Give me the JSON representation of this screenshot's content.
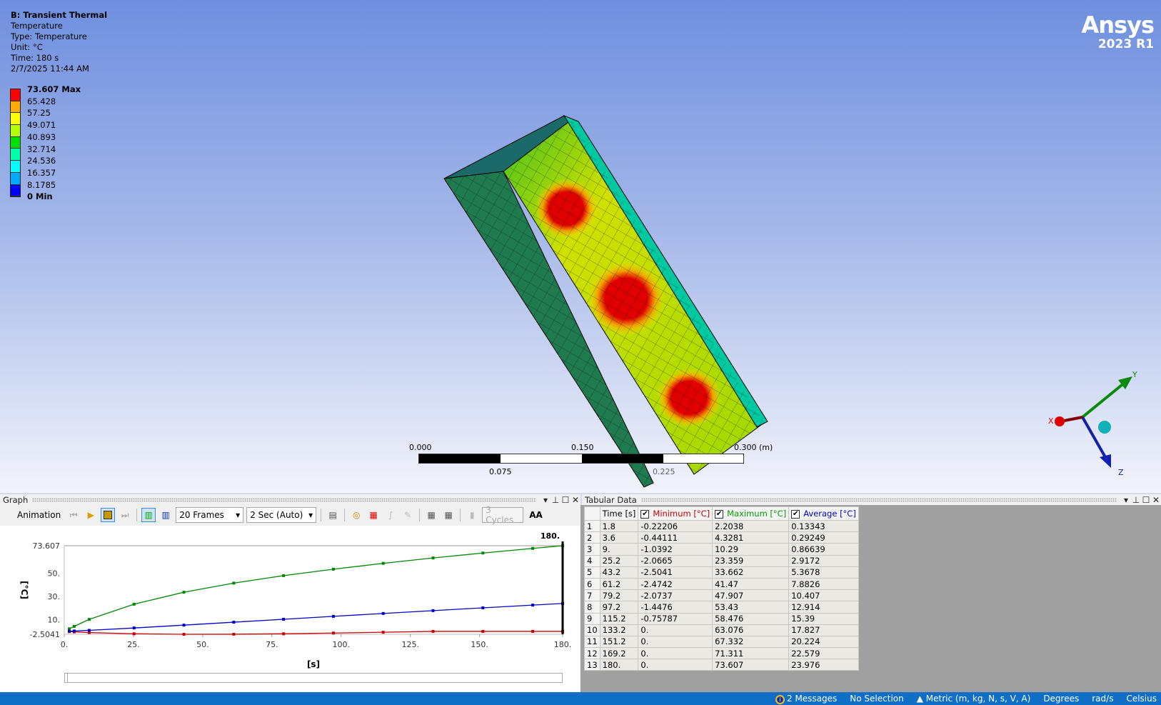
{
  "viewport": {
    "info": {
      "title": "B: Transient Thermal",
      "result": "Temperature",
      "type": "Type: Temperature",
      "unit": "Unit: °C",
      "time": "Time: 180 s",
      "date": "2/7/2025 11:44 AM"
    },
    "legend": {
      "labels": [
        "73.607 Max",
        "65.428",
        "57.25",
        "49.071",
        "40.893",
        "32.714",
        "24.536",
        "16.357",
        "8.1785",
        "0 Min"
      ],
      "colors": [
        "#ff0000",
        "#ffaa00",
        "#ffff00",
        "#b4ff00",
        "#00e000",
        "#00ffaa",
        "#00ffff",
        "#00aaff",
        "#0000ff"
      ]
    },
    "logo": {
      "name": "Ansys",
      "version": "2023 R1"
    },
    "scale_bar": {
      "l0": "0.000",
      "l1": "0.075",
      "l2": "0.150",
      "l3": "0.225",
      "l4": "0.300 (m)"
    },
    "triad": {
      "x": "X",
      "y": "Y",
      "z": "Z"
    }
  },
  "graph": {
    "title": "Graph",
    "toolbar": {
      "animation": "Animation",
      "frames": "20 Frames",
      "duration": "2 Sec (Auto)",
      "cycles": "3 Cycles",
      "aa": "AA"
    }
  },
  "chart_data": {
    "type": "line",
    "xlabel": "[s]",
    "ylabel": "[°C]",
    "xlim": [
      0,
      180
    ],
    "ylim": [
      -2.5041,
      73.607
    ],
    "xticks": [
      "0.",
      "25.",
      "50.",
      "75.",
      "100.",
      "125.",
      "150.",
      "180."
    ],
    "yticks": [
      "73.607",
      "50.",
      "30.",
      "10.",
      "-2.5041"
    ],
    "marker_label": "180.",
    "x": [
      1.8,
      3.6,
      9,
      25.2,
      43.2,
      61.2,
      79.2,
      97.2,
      115.2,
      133.2,
      151.2,
      169.2,
      180
    ],
    "series": [
      {
        "name": "Minimum [°C]",
        "color": "#cc0000",
        "values": [
          -0.22206,
          -0.44111,
          -1.0392,
          -2.0665,
          -2.5041,
          -2.4742,
          -2.0737,
          -1.4476,
          -0.75787,
          0,
          0,
          0,
          0
        ]
      },
      {
        "name": "Maximum [°C]",
        "color": "#008800",
        "values": [
          2.2038,
          4.3281,
          10.29,
          23.359,
          33.662,
          41.47,
          47.907,
          53.43,
          58.476,
          63.076,
          67.332,
          71.311,
          73.607
        ]
      },
      {
        "name": "Average [°C]",
        "color": "#0000cc",
        "values": [
          0.13343,
          0.29249,
          0.86639,
          2.9172,
          5.3678,
          7.8826,
          10.407,
          12.914,
          15.39,
          17.827,
          20.224,
          22.579,
          23.976
        ]
      }
    ]
  },
  "tabular": {
    "title": "Tabular Data",
    "headers": [
      "Time [s]",
      "Minimum [°C]",
      "Maximum [°C]",
      "Average [°C]"
    ],
    "rows": [
      [
        "1",
        "1.8",
        "-0.22206",
        "2.2038",
        "0.13343"
      ],
      [
        "2",
        "3.6",
        "-0.44111",
        "4.3281",
        "0.29249"
      ],
      [
        "3",
        "9.",
        "-1.0392",
        "10.29",
        "0.86639"
      ],
      [
        "4",
        "25.2",
        "-2.0665",
        "23.359",
        "2.9172"
      ],
      [
        "5",
        "43.2",
        "-2.5041",
        "33.662",
        "5.3678"
      ],
      [
        "6",
        "61.2",
        "-2.4742",
        "41.47",
        "7.8826"
      ],
      [
        "7",
        "79.2",
        "-2.0737",
        "47.907",
        "10.407"
      ],
      [
        "8",
        "97.2",
        "-1.4476",
        "53.43",
        "12.914"
      ],
      [
        "9",
        "115.2",
        "-0.75787",
        "58.476",
        "15.39"
      ],
      [
        "10",
        "133.2",
        "0.",
        "63.076",
        "17.827"
      ],
      [
        "11",
        "151.2",
        "0.",
        "67.332",
        "20.224"
      ],
      [
        "12",
        "169.2",
        "0.",
        "71.311",
        "22.579"
      ],
      [
        "13",
        "180.",
        "0.",
        "73.607",
        "23.976"
      ]
    ]
  },
  "status": {
    "messages": "2 Messages",
    "selection": "No Selection",
    "units": "Metric (m, kg, N, s, V, A)",
    "angle": "Degrees",
    "rot": "rad/s",
    "temp": "Celsius"
  }
}
